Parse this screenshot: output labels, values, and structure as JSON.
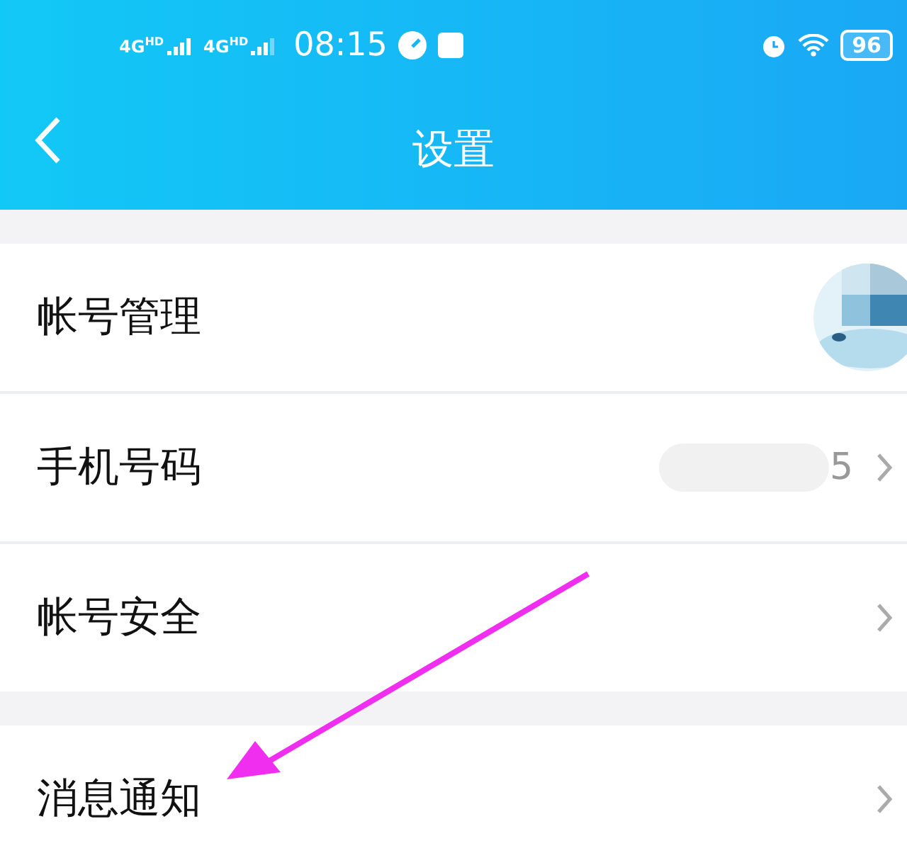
{
  "status_bar": {
    "signals": [
      "4G$^{HD}$",
      "4G$^{HD}$"
    ],
    "time": "08:15",
    "battery": "96"
  },
  "header": {
    "title": "设置"
  },
  "groups": [
    {
      "rows": [
        {
          "kind": "avatar",
          "label": "帐号管理"
        },
        {
          "kind": "value",
          "label": "手机号码",
          "value": "5"
        },
        {
          "kind": "plain",
          "label": "帐号安全"
        }
      ]
    },
    {
      "rows": [
        {
          "kind": "plain",
          "label": "消息通知"
        }
      ]
    }
  ]
}
